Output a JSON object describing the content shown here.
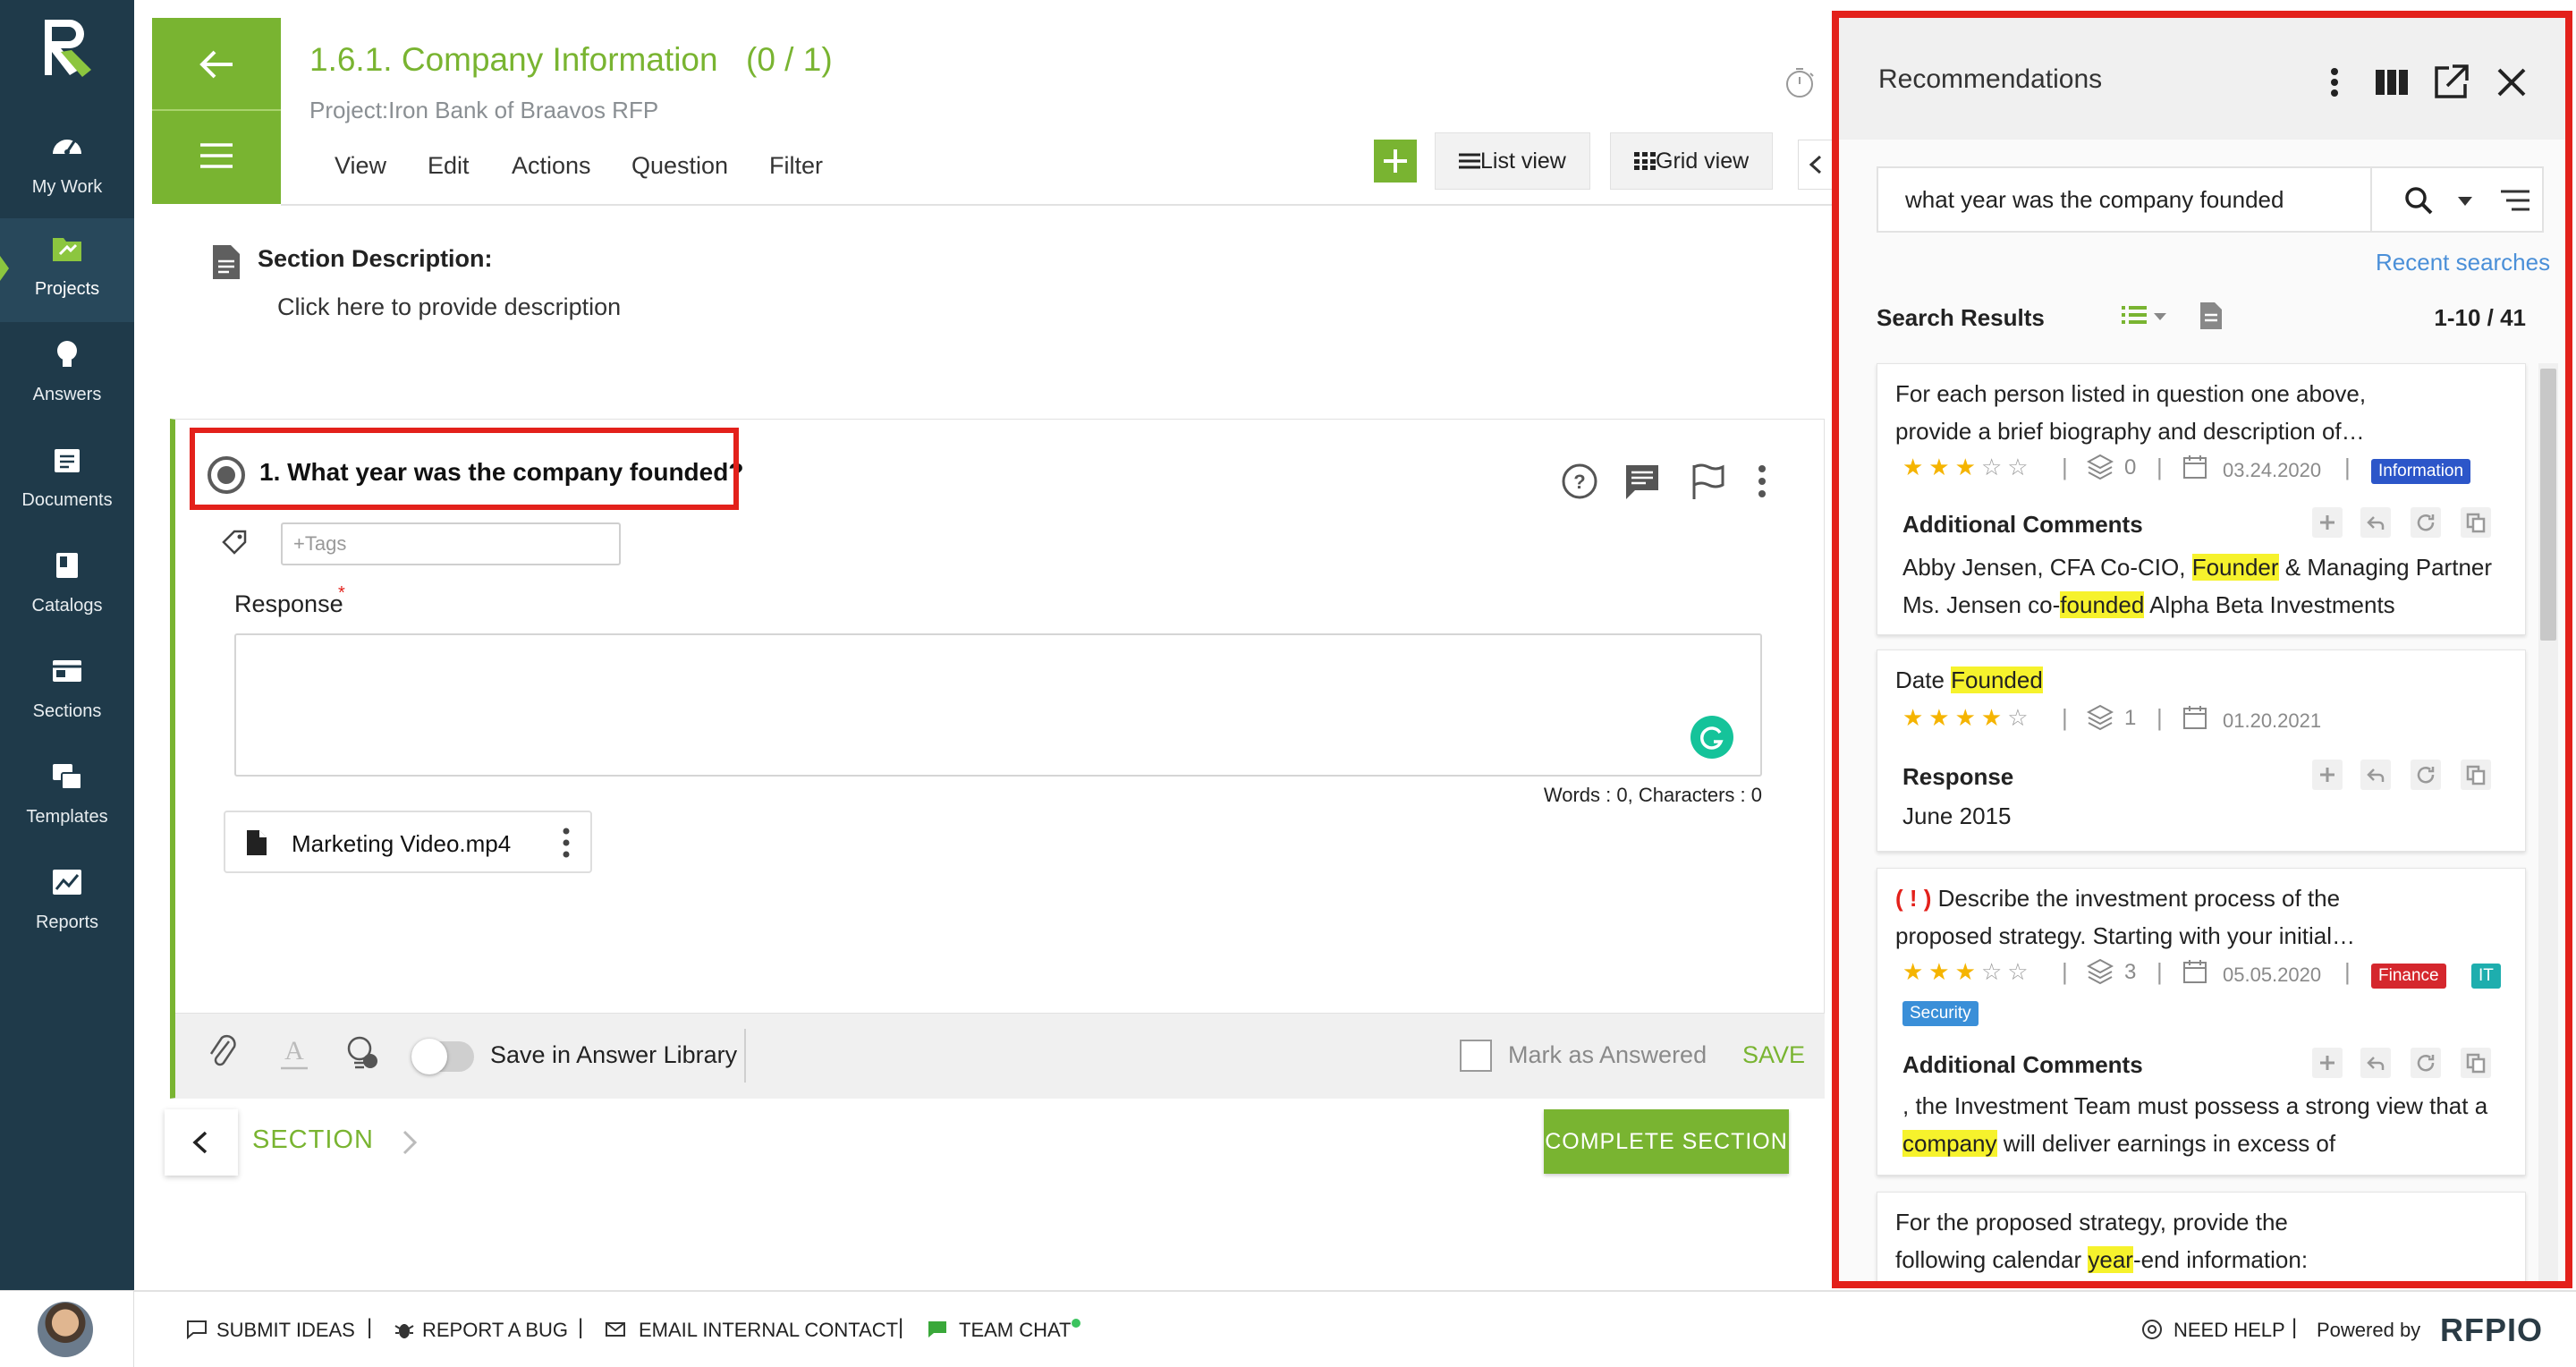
{
  "sidebar": {
    "items": [
      {
        "label": "My Work",
        "icon": "dashboard-icon"
      },
      {
        "label": "Projects",
        "icon": "folder-icon"
      },
      {
        "label": "Answers",
        "icon": "lightbulb-icon"
      },
      {
        "label": "Documents",
        "icon": "documents-icon"
      },
      {
        "label": "Catalogs",
        "icon": "catalog-icon"
      },
      {
        "label": "Sections",
        "icon": "sections-icon"
      },
      {
        "label": "Templates",
        "icon": "templates-icon"
      },
      {
        "label": "Reports",
        "icon": "reports-icon"
      }
    ],
    "active": "Projects"
  },
  "header": {
    "title": "1.6.1. Company Information",
    "count": "(0 / 1)",
    "project": "Project:Iron Bank of Braavos RFP",
    "menu": [
      "View",
      "Edit",
      "Actions",
      "Question",
      "Filter"
    ],
    "list_view": "List view",
    "grid_view": "Grid view"
  },
  "section_description": {
    "label": "Section Description:",
    "placeholder": "Click here to provide description"
  },
  "question": {
    "title": "1. What year was the company founded?",
    "tags_placeholder": "+Tags",
    "response_label": "Response",
    "required_mark": "*",
    "response_value": "",
    "word_count": "Words : 0, Characters : 0",
    "attachment": "Marketing Video.mp4",
    "save_library_label": "Save in Answer Library",
    "mark_answered_label": "Mark as Answered",
    "save_label": "SAVE"
  },
  "section_nav": {
    "label": "SECTION",
    "complete_label": "COMPLETE SECTION"
  },
  "bottom_bar": {
    "submit_ideas": "SUBMIT IDEAS",
    "report_bug": "REPORT A BUG",
    "email_contact": "EMAIL INTERNAL CONTACT",
    "team_chat": "TEAM CHAT",
    "need_help": "NEED HELP",
    "powered_by": "Powered by",
    "brand": "RFPIO",
    "separator": "|"
  },
  "recommendations": {
    "title": "Recommendations",
    "search_value": "what year was the company founded",
    "recent_searches": "Recent searches",
    "results_label": "Search Results",
    "results_count": "1-10 / 41",
    "cards": [
      {
        "line1": "For each person listed in question one above,",
        "line2": "provide a brief biography and description of…",
        "rating": 3,
        "versions": "0",
        "date": "03.24.2020",
        "tags": [
          "Information"
        ],
        "sub_label": "Additional Comments",
        "body1_pre": "Abby Jensen, CFA Co-CIO, ",
        "body1_hl": "Founder",
        "body1_post": " & Managing Partner",
        "body2_pre": "Ms. Jensen co-",
        "body2_hl": "founded",
        "body2_post": " Alpha Beta Investments"
      },
      {
        "line1_pre": "Date ",
        "line1_hl": "Founded",
        "rating": 4,
        "versions": "1",
        "date": "01.20.2021",
        "sub_label": "Response",
        "body1": "June 2015"
      },
      {
        "flag": "( ! )",
        "line1": "Describe the investment process of the",
        "line2": "proposed strategy. Starting with your initial…",
        "rating": 3,
        "versions": "3",
        "date": "05.05.2020",
        "tags": [
          "Finance",
          "IT",
          "Security"
        ],
        "sub_label": "Additional Comments",
        "body1": ", the Investment Team must possess a strong view that a",
        "body2_hl": "company",
        "body2_post": " will deliver earnings in excess of"
      },
      {
        "line1": "For the proposed strategy, provide the",
        "line2_pre": "following calendar ",
        "line2_hl": "year",
        "line2_post": "-end information:"
      }
    ]
  },
  "colors": {
    "sidebar": "#1f3a4a",
    "accent_green": "#79b431",
    "highlight_red": "#e3211b",
    "highlight_yellow": "#f6f22c"
  }
}
